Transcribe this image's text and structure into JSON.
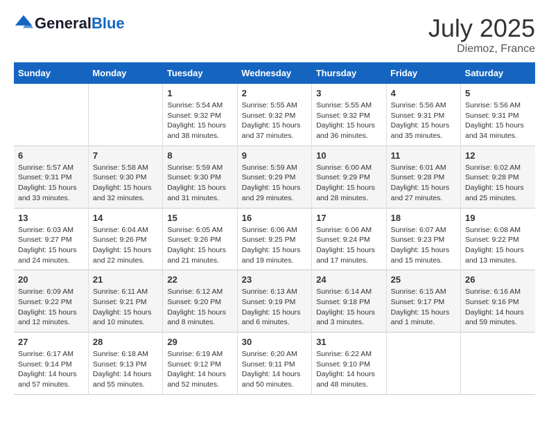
{
  "header": {
    "logo_text_general": "General",
    "logo_text_blue": "Blue",
    "month_year": "July 2025",
    "location": "Diemoz, France"
  },
  "days_of_week": [
    "Sunday",
    "Monday",
    "Tuesday",
    "Wednesday",
    "Thursday",
    "Friday",
    "Saturday"
  ],
  "weeks": [
    [
      {
        "day": "",
        "content": ""
      },
      {
        "day": "",
        "content": ""
      },
      {
        "day": "1",
        "content": "Sunrise: 5:54 AM\nSunset: 9:32 PM\nDaylight: 15 hours and 38 minutes."
      },
      {
        "day": "2",
        "content": "Sunrise: 5:55 AM\nSunset: 9:32 PM\nDaylight: 15 hours and 37 minutes."
      },
      {
        "day": "3",
        "content": "Sunrise: 5:55 AM\nSunset: 9:32 PM\nDaylight: 15 hours and 36 minutes."
      },
      {
        "day": "4",
        "content": "Sunrise: 5:56 AM\nSunset: 9:31 PM\nDaylight: 15 hours and 35 minutes."
      },
      {
        "day": "5",
        "content": "Sunrise: 5:56 AM\nSunset: 9:31 PM\nDaylight: 15 hours and 34 minutes."
      }
    ],
    [
      {
        "day": "6",
        "content": "Sunrise: 5:57 AM\nSunset: 9:31 PM\nDaylight: 15 hours and 33 minutes."
      },
      {
        "day": "7",
        "content": "Sunrise: 5:58 AM\nSunset: 9:30 PM\nDaylight: 15 hours and 32 minutes."
      },
      {
        "day": "8",
        "content": "Sunrise: 5:59 AM\nSunset: 9:30 PM\nDaylight: 15 hours and 31 minutes."
      },
      {
        "day": "9",
        "content": "Sunrise: 5:59 AM\nSunset: 9:29 PM\nDaylight: 15 hours and 29 minutes."
      },
      {
        "day": "10",
        "content": "Sunrise: 6:00 AM\nSunset: 9:29 PM\nDaylight: 15 hours and 28 minutes."
      },
      {
        "day": "11",
        "content": "Sunrise: 6:01 AM\nSunset: 9:28 PM\nDaylight: 15 hours and 27 minutes."
      },
      {
        "day": "12",
        "content": "Sunrise: 6:02 AM\nSunset: 9:28 PM\nDaylight: 15 hours and 25 minutes."
      }
    ],
    [
      {
        "day": "13",
        "content": "Sunrise: 6:03 AM\nSunset: 9:27 PM\nDaylight: 15 hours and 24 minutes."
      },
      {
        "day": "14",
        "content": "Sunrise: 6:04 AM\nSunset: 9:26 PM\nDaylight: 15 hours and 22 minutes."
      },
      {
        "day": "15",
        "content": "Sunrise: 6:05 AM\nSunset: 9:26 PM\nDaylight: 15 hours and 21 minutes."
      },
      {
        "day": "16",
        "content": "Sunrise: 6:06 AM\nSunset: 9:25 PM\nDaylight: 15 hours and 19 minutes."
      },
      {
        "day": "17",
        "content": "Sunrise: 6:06 AM\nSunset: 9:24 PM\nDaylight: 15 hours and 17 minutes."
      },
      {
        "day": "18",
        "content": "Sunrise: 6:07 AM\nSunset: 9:23 PM\nDaylight: 15 hours and 15 minutes."
      },
      {
        "day": "19",
        "content": "Sunrise: 6:08 AM\nSunset: 9:22 PM\nDaylight: 15 hours and 13 minutes."
      }
    ],
    [
      {
        "day": "20",
        "content": "Sunrise: 6:09 AM\nSunset: 9:22 PM\nDaylight: 15 hours and 12 minutes."
      },
      {
        "day": "21",
        "content": "Sunrise: 6:11 AM\nSunset: 9:21 PM\nDaylight: 15 hours and 10 minutes."
      },
      {
        "day": "22",
        "content": "Sunrise: 6:12 AM\nSunset: 9:20 PM\nDaylight: 15 hours and 8 minutes."
      },
      {
        "day": "23",
        "content": "Sunrise: 6:13 AM\nSunset: 9:19 PM\nDaylight: 15 hours and 6 minutes."
      },
      {
        "day": "24",
        "content": "Sunrise: 6:14 AM\nSunset: 9:18 PM\nDaylight: 15 hours and 3 minutes."
      },
      {
        "day": "25",
        "content": "Sunrise: 6:15 AM\nSunset: 9:17 PM\nDaylight: 15 hours and 1 minute."
      },
      {
        "day": "26",
        "content": "Sunrise: 6:16 AM\nSunset: 9:16 PM\nDaylight: 14 hours and 59 minutes."
      }
    ],
    [
      {
        "day": "27",
        "content": "Sunrise: 6:17 AM\nSunset: 9:14 PM\nDaylight: 14 hours and 57 minutes."
      },
      {
        "day": "28",
        "content": "Sunrise: 6:18 AM\nSunset: 9:13 PM\nDaylight: 14 hours and 55 minutes."
      },
      {
        "day": "29",
        "content": "Sunrise: 6:19 AM\nSunset: 9:12 PM\nDaylight: 14 hours and 52 minutes."
      },
      {
        "day": "30",
        "content": "Sunrise: 6:20 AM\nSunset: 9:11 PM\nDaylight: 14 hours and 50 minutes."
      },
      {
        "day": "31",
        "content": "Sunrise: 6:22 AM\nSunset: 9:10 PM\nDaylight: 14 hours and 48 minutes."
      },
      {
        "day": "",
        "content": ""
      },
      {
        "day": "",
        "content": ""
      }
    ]
  ]
}
